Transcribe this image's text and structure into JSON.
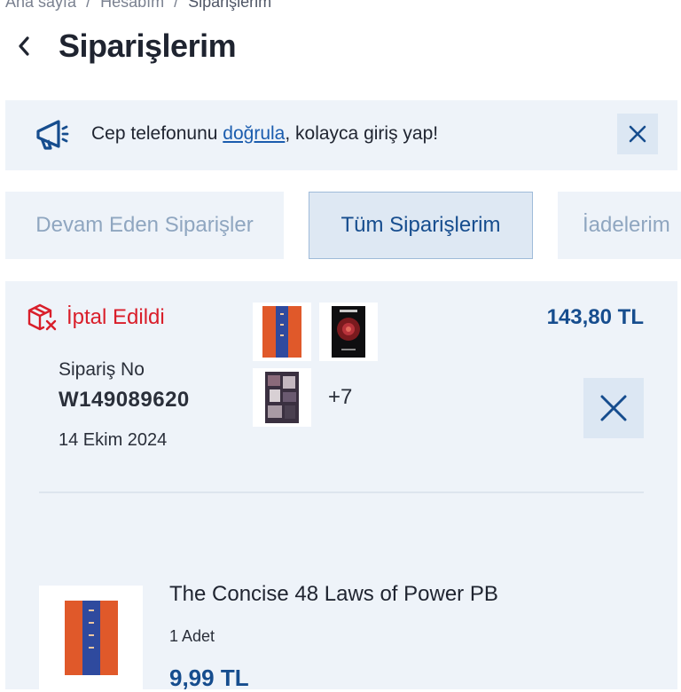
{
  "breadcrumb": {
    "home": "Ana sayfa",
    "account": "Hesabım",
    "current": "Siparişlerim",
    "separator": "/"
  },
  "page": {
    "title": "Siparişlerim"
  },
  "banner": {
    "text_before": "Cep telefonunu ",
    "link": "doğrula",
    "text_after": ", kolayca giriş yap!"
  },
  "tabs": [
    {
      "label": "Devam Eden Siparişler",
      "active": false
    },
    {
      "label": "Tüm Siparişlerim",
      "active": true
    },
    {
      "label": "İadelerim",
      "active": false
    }
  ],
  "order": {
    "status": "İptal Edildi",
    "order_no_label": "Sipariş No",
    "order_no": "W149089620",
    "date": "14 Ekim 2024",
    "total": "143,80 TL",
    "more_items": "+7",
    "thumbnails": [
      "book-48-laws-orange-blue",
      "book-dark-red-cover",
      "book-collage-cover"
    ]
  },
  "item": {
    "name": "The Concise 48 Laws of Power PB",
    "quantity": "1 Adet",
    "price": "9,99 TL"
  },
  "colors": {
    "brand": "#164d8e",
    "link": "#1a5cae",
    "cancelled": "#d91e2a",
    "panel": "#eef3f9"
  }
}
